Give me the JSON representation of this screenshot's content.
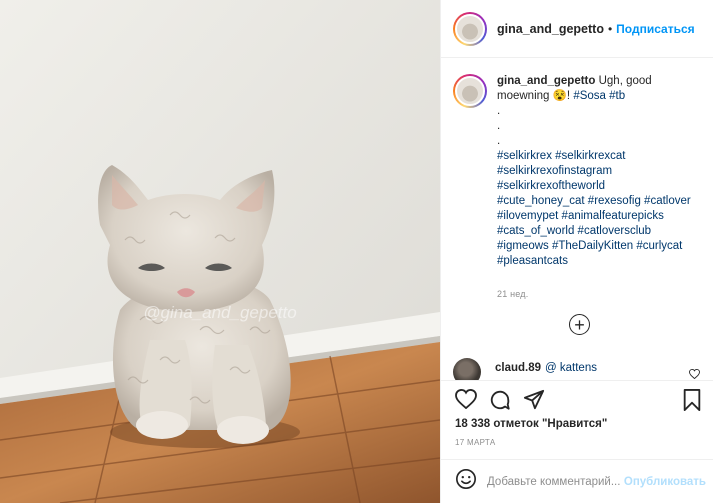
{
  "photo": {
    "watermark": "@gina_and_gepetto",
    "alt": "curly cream kitten"
  },
  "header": {
    "username": "gina_and_gepetto",
    "separator": "•",
    "follow_label": "Подписаться"
  },
  "caption": {
    "username": "gina_and_gepetto",
    "text_start": "Ugh, good moewning 😵! ",
    "inline_tags": [
      "#Sosa",
      "#tb"
    ],
    "dots": [
      ".",
      ".",
      "."
    ],
    "hashtag_lines": [
      "#selkirkrex #selkirkrexcat",
      "#selkirkrexofinstagram",
      "#selkirkrexoftheworld",
      "#cute_honey_cat #rexesofig #catlover",
      "#ilovemypet #animalfeaturepicks",
      "#cats_of_world #catloversclub",
      "#igmeows #TheDailyKitten #curlycat",
      "#pleasantcats"
    ],
    "time": "21 нед."
  },
  "load_more": "+",
  "comment": {
    "username": "claud.89",
    "text": "@ kattens"
  },
  "icons": {
    "like": "heart-icon",
    "comment": "comment-icon",
    "share": "share-icon",
    "save": "bookmark-icon",
    "emoji": "emoji-icon"
  },
  "likes": "18 338 отметок \"Нравится\"",
  "date": "17 МАРТА",
  "add_comment": {
    "placeholder": "Добавьте комментарий...",
    "publish_label": "Опубликовать"
  }
}
